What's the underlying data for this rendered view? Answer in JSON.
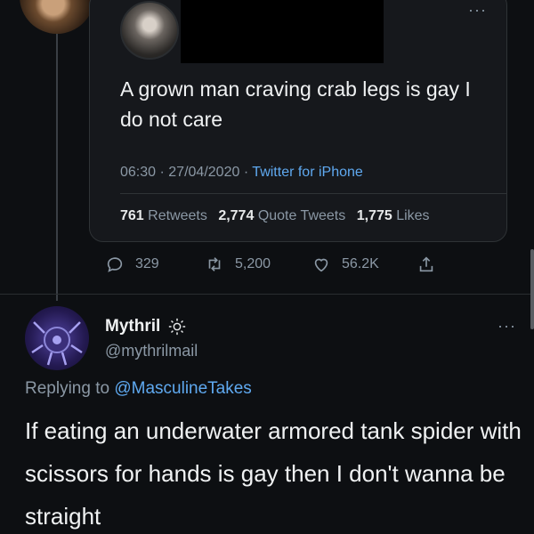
{
  "quoted_tweet": {
    "text": "A grown man craving crab legs is gay I do not care",
    "time": "06:30",
    "date": "27/04/2020",
    "source": "Twitter for iPhone",
    "retweets_count": "761",
    "retweets_label": "Retweets",
    "quote_tweets_count": "2,774",
    "quote_tweets_label": "Quote Tweets",
    "likes_count": "1,775",
    "likes_label": "Likes",
    "more_label": "···"
  },
  "actions": {
    "replies": "329",
    "retweets": "5,200",
    "likes": "56.2K"
  },
  "reply_tweet": {
    "display_name": "Mythril",
    "handle": "@mythrilmail",
    "replying_prefix": "Replying to",
    "replying_to": "@MasculineTakes",
    "text": "If eating an underwater armored tank spider with scissors for hands is gay then I don't wanna be straight",
    "more_label": "···"
  },
  "colors": {
    "background": "#0d0f12",
    "accent": "#5fa9f0",
    "muted": "#8b98a5"
  },
  "icons": [
    "reply-icon",
    "retweet-icon",
    "like-icon",
    "share-icon",
    "sun-emoji-icon",
    "more-icon"
  ]
}
